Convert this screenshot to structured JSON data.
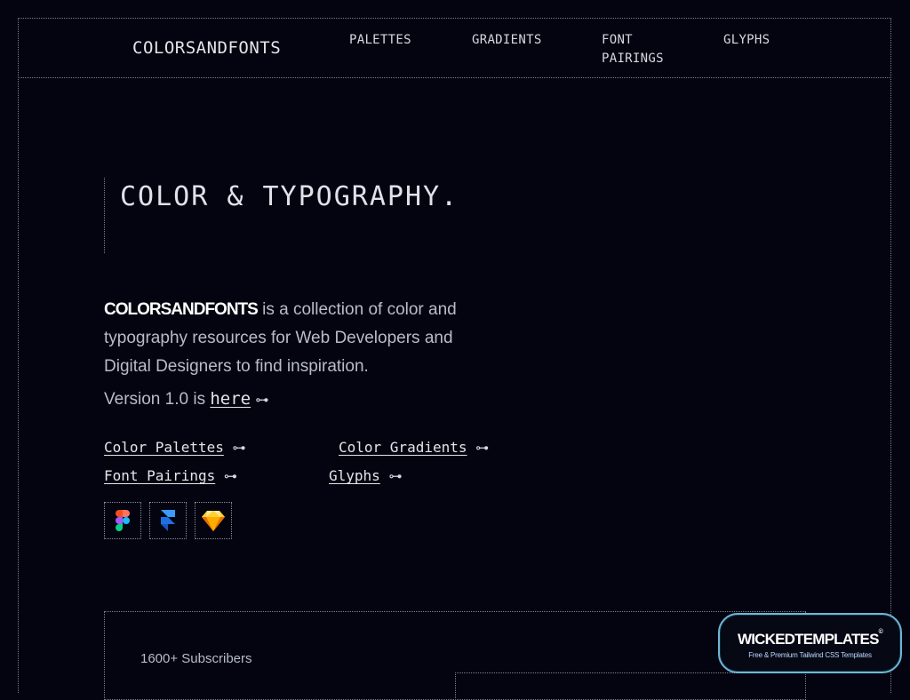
{
  "header": {
    "logo": "COLORSANDFONTS",
    "nav": [
      "PALETTES",
      "GRADIENTS",
      "FONT\nPAIRINGS",
      "GLYPHS"
    ]
  },
  "hero": {
    "title": "COLOR & TYPOGRAPHY.",
    "brand": "COLORSANDFONTS",
    "description": " is a collection of color and typography resources for Web Developers and Digital Designers to find inspiration.",
    "version_prefix": "Version 1.0 is ",
    "version_link": "here",
    "arrow": "⊶"
  },
  "resources": [
    {
      "label": "Color Palettes"
    },
    {
      "label": "Color Gradients"
    },
    {
      "label": "Font Pairings"
    },
    {
      "label": "Glyphs"
    }
  ],
  "tools": [
    {
      "icon": "figma-icon"
    },
    {
      "icon": "framer-icon"
    },
    {
      "icon": "sketch-icon"
    }
  ],
  "subscribe": {
    "count_text": "1600+ Subscribers"
  },
  "badge": {
    "title": "WICKEDTEMPLATES",
    "mark": "©",
    "subtitle": "Free & Premium Tailwind CSS Templates"
  }
}
